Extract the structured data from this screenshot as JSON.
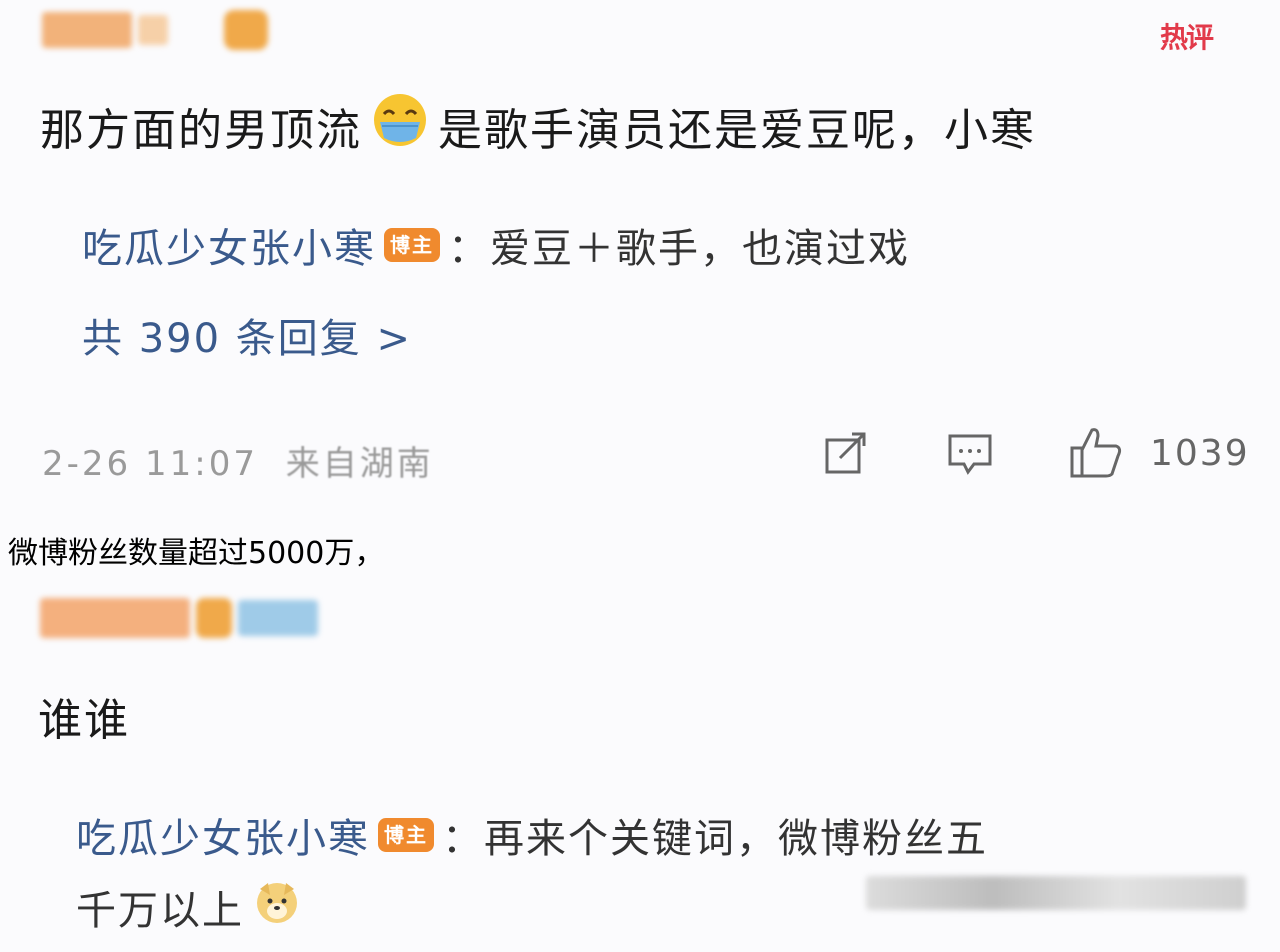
{
  "comment1": {
    "hot_label": "热评",
    "text_before_emoji": "那方面的男顶流",
    "text_after_emoji": "是歌手演员还是爱豆呢，小寒",
    "reply": {
      "author": "吃瓜少女张小寒",
      "badge": "博主",
      "content": "：爱豆＋歌手，也演过戏"
    },
    "more_replies": "共 390 条回复 >",
    "meta": {
      "timestamp": "2-26 11:07",
      "source": "来自湖南"
    },
    "like_count": "1039",
    "icons": [
      "share-icon",
      "comment-icon",
      "like-icon",
      "emoji-mask-icon"
    ]
  },
  "caption": "微博粉丝数量超过5000万，",
  "comment2": {
    "text": "谁谁",
    "reply": {
      "author": "吃瓜少女张小寒",
      "badge": "博主",
      "content_line1": "：再来个关键词，微博粉丝五",
      "content_line2": "千万以上"
    },
    "icons": [
      "doge-icon"
    ]
  },
  "colors": {
    "author_link": "#3a5a8c",
    "badge": "#f08a2e",
    "hot": "#e23a4a",
    "meta": "#9a9a9a"
  }
}
